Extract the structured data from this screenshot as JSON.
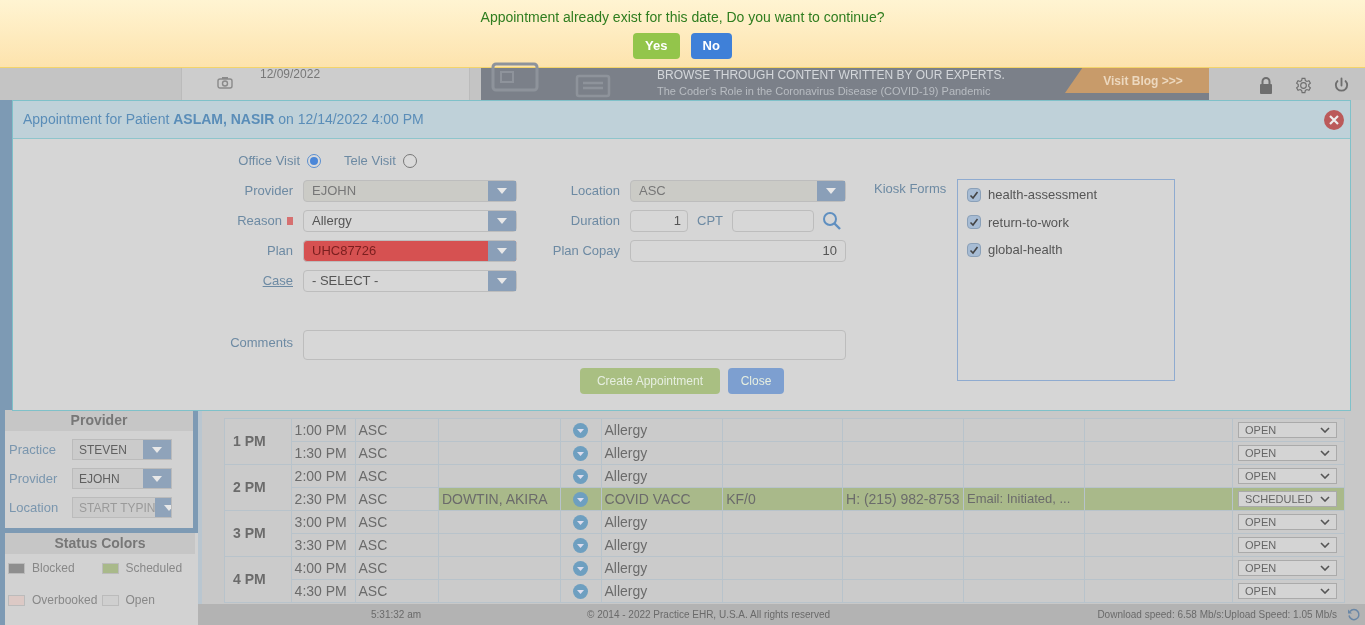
{
  "alert": {
    "message": "Appointment already exist for this date, Do you want to continue?",
    "buttons": [
      {
        "label": "Yes",
        "kind": "confirm"
      },
      {
        "label": "No",
        "kind": "cancel"
      }
    ]
  },
  "header": {
    "date": "12/09/2022",
    "banner_heading": "BROWSE THROUGH CONTENT WRITTEN BY OUR EXPERTS.",
    "banner_text": "The Coder's Role in the Coronavirus Disease (COVID-19) Pandemic",
    "banner_link": "Visit Blog >>>"
  },
  "dialog": {
    "title": "Appointment for Patient **ASLAM, NASIR** on 12/14/2022 4:00 PM",
    "visit_types": [
      {
        "label": "Office Visit",
        "selected": true
      },
      {
        "label": "Tele Visit",
        "selected": false
      }
    ],
    "left_fields": [
      {
        "label": "Provider",
        "value": "EJOHN",
        "required": false,
        "disabled": true,
        "error": false,
        "link": false
      },
      {
        "label": "Reason",
        "value": "Allergy",
        "required": true,
        "disabled": false,
        "error": false,
        "link": false
      },
      {
        "label": "Plan",
        "value": "UHC87726",
        "required": false,
        "disabled": false,
        "error": true,
        "link": false
      },
      {
        "label": "Case",
        "value": "- SELECT -",
        "required": false,
        "disabled": false,
        "error": false,
        "link": true
      }
    ],
    "location": {
      "label": "Location",
      "value": "ASC"
    },
    "duration": {
      "label": "Duration",
      "value": "1"
    },
    "cpt": {
      "label": "CPT"
    },
    "plan_copay": {
      "label": "Plan Copay",
      "value": "10"
    },
    "comments": {
      "label": "Comments"
    },
    "kiosk_forms": {
      "label": "Kiosk Forms",
      "items": [
        {
          "label": "health-assessment",
          "checked": true
        },
        {
          "label": "return-to-work",
          "checked": true
        },
        {
          "label": "global-health",
          "checked": true
        }
      ]
    },
    "buttons": [
      {
        "label": "Create Appointment",
        "kind": "primary"
      },
      {
        "label": "Close",
        "kind": "secondary"
      }
    ]
  },
  "sidebar": {
    "provider_panel": {
      "title": "Provider",
      "fields": [
        {
          "label": "Practice",
          "value": "STEVEN"
        },
        {
          "label": "Provider",
          "value": "EJOHN"
        },
        {
          "label": "Location",
          "placeholder": "START TYPIN"
        }
      ]
    },
    "status_colors": {
      "title": "Status Colors",
      "items": [
        {
          "label": "Blocked",
          "color": "#8e8e8e"
        },
        {
          "label": "Scheduled",
          "color": "#a9b98a"
        },
        {
          "label": "Overbooked",
          "color": "#dcc9c5"
        },
        {
          "label": "Open",
          "color": "#cfcfcf"
        }
      ]
    }
  },
  "schedule": [
    {
      "hour": "1 PM",
      "slots": [
        {
          "time": "1:00 PM",
          "location": "ASC",
          "reason": "Allergy",
          "status": "OPEN",
          "scheduled": false
        },
        {
          "time": "1:30 PM",
          "location": "ASC",
          "reason": "Allergy",
          "status": "OPEN",
          "scheduled": false
        }
      ]
    },
    {
      "hour": "2 PM",
      "slots": [
        {
          "time": "2:00 PM",
          "location": "ASC",
          "reason": "Allergy",
          "status": "OPEN",
          "scheduled": false
        },
        {
          "time": "2:30 PM",
          "location": "ASC",
          "patient": "DOWTIN, AKIRA",
          "reason": "COVID VACC",
          "column_7": "KF/0",
          "phone": "H: (215) 982-8753",
          "email": "Email: Initiated, ...",
          "status": "SCHEDULED",
          "scheduled": true
        }
      ]
    },
    {
      "hour": "3 PM",
      "slots": [
        {
          "time": "3:00 PM",
          "location": "ASC",
          "reason": "Allergy",
          "status": "OPEN",
          "scheduled": false
        },
        {
          "time": "3:30 PM",
          "location": "ASC",
          "reason": "Allergy",
          "status": "OPEN",
          "scheduled": false
        }
      ]
    },
    {
      "hour": "4 PM",
      "slots": [
        {
          "time": "4:00 PM",
          "location": "ASC",
          "reason": "Allergy",
          "status": "OPEN",
          "scheduled": false
        },
        {
          "time": "4:30 PM",
          "location": "ASC",
          "reason": "Allergy",
          "status": "OPEN",
          "scheduled": false
        }
      ]
    }
  ],
  "footer": {
    "time": "5:31:32 am",
    "copyright": "© 2014 - 2022 Practice EHR, U.S.A. All rights reserved",
    "speed": "Download speed: 6.58 Mb/s:Upload Speed: 1.05 Mb/s"
  }
}
